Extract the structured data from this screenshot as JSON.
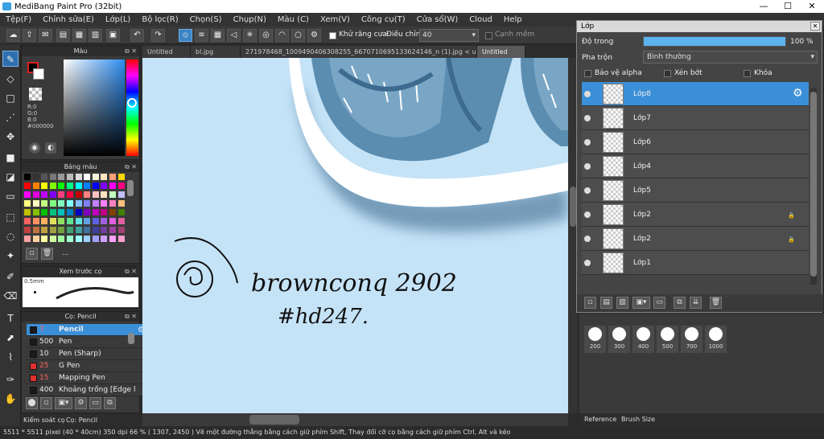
{
  "window": {
    "title": "MediBang Paint Pro (32bit)"
  },
  "menu": [
    "Tệp(F)",
    "Chỉnh sửa(E)",
    "Lớp(L)",
    "Bộ lọc(R)",
    "Chọn(S)",
    "Chụp(N)",
    "Màu (C)",
    "Xem(V)",
    "Công cụ(T)",
    "Cửa sổ(W)",
    "Cloud",
    "Help"
  ],
  "toolbar": {
    "antialias_label": "Khử răng cưa",
    "adjust_label": "Điều chỉnh",
    "adjust_value": "40",
    "edge_label": "Cạnh mềm"
  },
  "tabs": [
    "Untitled",
    "bl.jpg",
    "271978468_1009490406308255_6670710695133624146_n (1).jpg < uRGB >",
    "Untitled"
  ],
  "color_panel": {
    "title": "Màu",
    "r": "R:0",
    "g": "G:0",
    "b": "B:0",
    "hex": "#000000"
  },
  "palette_panel": {
    "title": "Bảng màu",
    "more": "..."
  },
  "preview_panel": {
    "title": "Xem trước cọ",
    "size": "0.5mm"
  },
  "brush_panel": {
    "title": "Cọ: Pencil",
    "brushes": [
      {
        "size": "7",
        "name": "Pencil",
        "color": "#1a1a1a"
      },
      {
        "size": "500",
        "name": "Pen",
        "color": "#1a1a1a"
      },
      {
        "size": "10",
        "name": "Pen (Sharp)",
        "color": "#1a1a1a"
      },
      {
        "size": "25",
        "name": "G Pen",
        "color": "#e03030"
      },
      {
        "size": "15",
        "name": "Mapping Pen",
        "color": "#e03030"
      },
      {
        "size": "400",
        "name": "Khoảng trống [Edge l",
        "color": "#1a1a1a"
      }
    ]
  },
  "bottom_tabs": [
    "Kiểm soát cọ",
    "Cọ: Pencil"
  ],
  "layer_window": {
    "title": "Lớp",
    "opacity_label": "Độ trong",
    "opacity_value": "100 %",
    "opacity_fraction": 1.0,
    "blend_label": "Pha trộn",
    "blend_value": "Bình thường",
    "protect_alpha": "Bảo vệ alpha",
    "clipping": "Xén bớt",
    "lock": "Khóa",
    "layers": [
      {
        "name": "Lớp8",
        "selected": true
      },
      {
        "name": "Lớp7",
        "selected": false
      },
      {
        "name": "Lớp6",
        "selected": false
      },
      {
        "name": "Lớp4",
        "selected": false
      },
      {
        "name": "Lớp5",
        "selected": false
      },
      {
        "name": "Lớp2",
        "selected": false,
        "locked": true
      },
      {
        "name": "Lớp2",
        "selected": false,
        "locked": true
      },
      {
        "name": "Lớp1",
        "selected": false
      }
    ]
  },
  "brush_sizes": [
    "200",
    "300",
    "400",
    "500",
    "700",
    "1000"
  ],
  "right_tabs": [
    "Reference",
    "Brush Size"
  ],
  "status": "5511 * 5511 pixel   (40 * 40cm)   350 dpi   66 %   ( 1307, 2450 )   Vẽ một đường thẳng bằng cách giữ phím Shift, Thay đổi cỡ cọ bằng cách giữ phím Ctrl, Alt và kéo",
  "canvas_text": {
    "line1": "brownconq 2902",
    "line2": "#hd247."
  },
  "colors": {
    "accent": "#3b8fd8",
    "canvas_bg": "#c5e3f7",
    "art_blue": "#5b8db0"
  }
}
